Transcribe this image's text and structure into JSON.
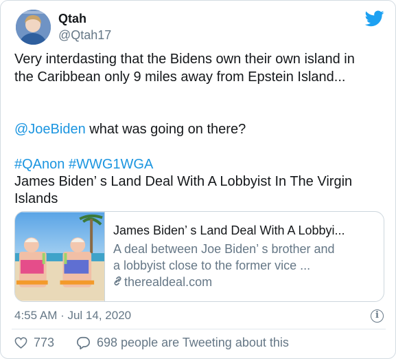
{
  "tweet": {
    "display_name": "Qtah",
    "handle": "@Qtah17",
    "avatar_icon": "profile-avatar",
    "platform_icon": "twitter-bird-icon",
    "brand_color": "#1da1f2",
    "link_color": "#1b95e0",
    "text": {
      "line1": "Very interdasting that the Bidens own their own island in",
      "line2": "the Caribbean only 9 miles away from Epstein Island...",
      "mention": "@JoeBiden",
      "mention_rest": " what was going on there?",
      "hashtag1": "#QAnon",
      "hashtag2": "#WWG1WGA",
      "headline_line1": "James Biden’ s Land Deal With A Lobbyist In The Virgin",
      "headline_line2": "Islands"
    },
    "link_card": {
      "title": "James Biden’ s Land Deal With A Lobbyi...",
      "description_line1": "A deal between Joe Biden’ s brother and",
      "description_line2": "a lobbyist close to the former vice ...",
      "domain": "therealdeal.com"
    },
    "timestamp": "4:55 AM · Jul 14, 2020",
    "info_icon": "i",
    "likes_count": "773",
    "conversation_text": "698 people are Tweeting about this"
  }
}
